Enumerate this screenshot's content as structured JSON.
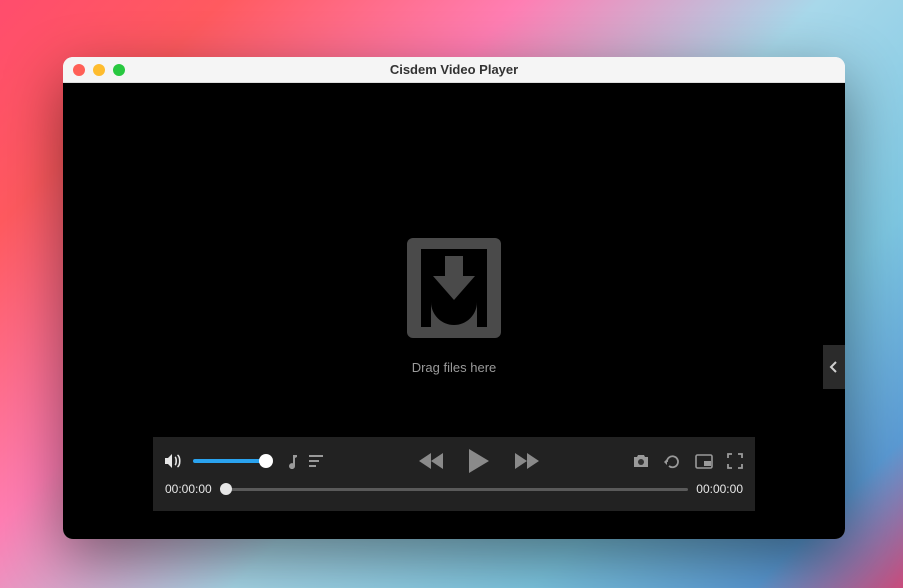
{
  "window": {
    "title": "Cisdem Video Player"
  },
  "dropzone": {
    "label": "Drag files here"
  },
  "player": {
    "current_time": "00:00:00",
    "total_time": "00:00:00",
    "volume_percent": 100,
    "progress_percent": 0
  },
  "colors": {
    "volume_track": "#2aa3ef"
  }
}
